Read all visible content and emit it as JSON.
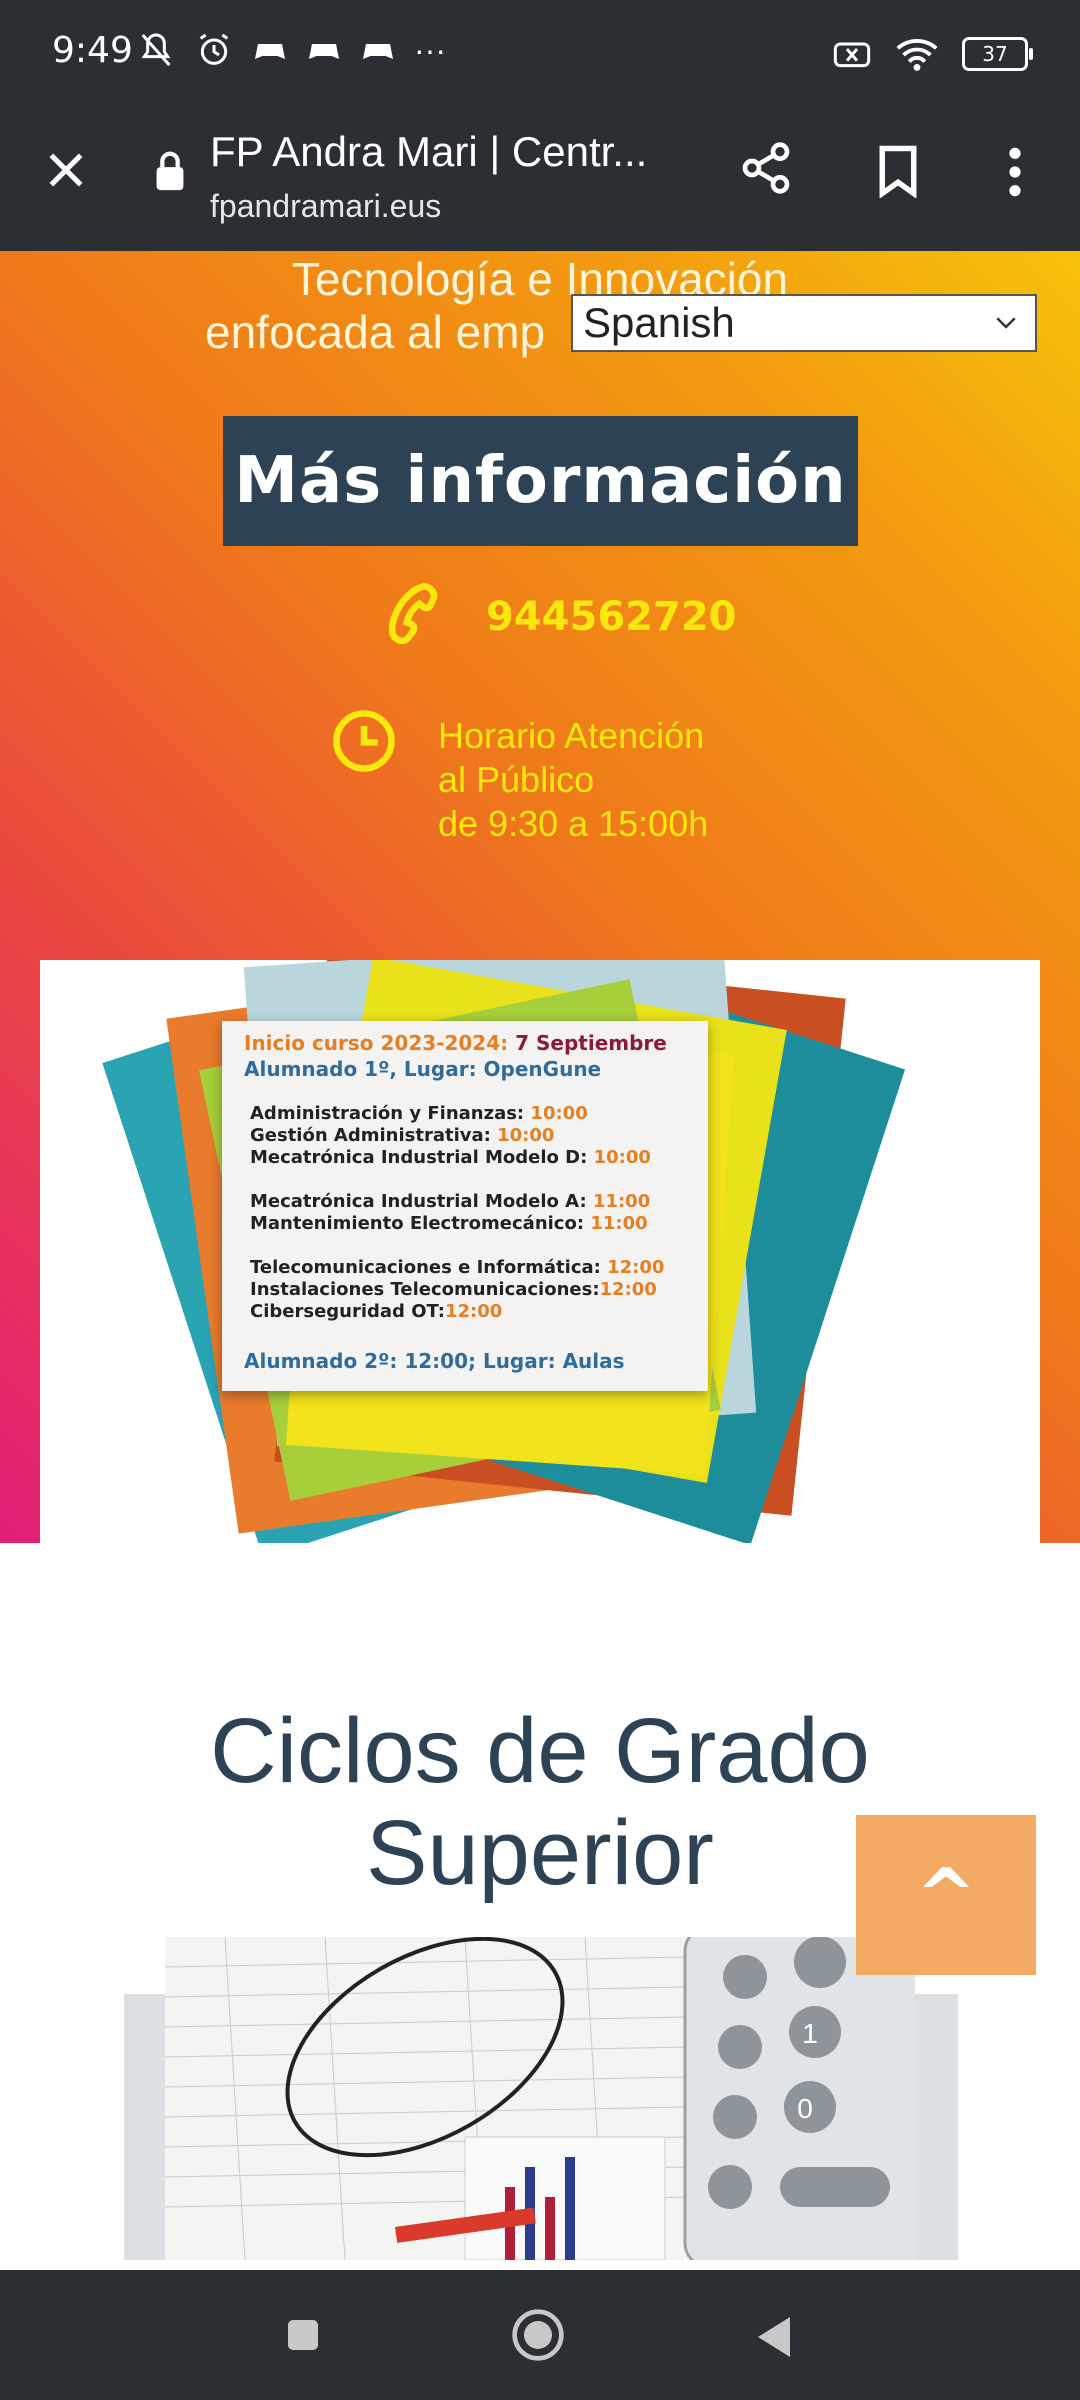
{
  "status_bar": {
    "time": "9:49",
    "battery": "37",
    "more": "···"
  },
  "browser": {
    "title": "FP Andra Mari | Centr...",
    "url": "fpandramari.eus",
    "icons": [
      "close-icon",
      "lock-icon",
      "share-icon",
      "bookmark-icon",
      "more-vert-icon"
    ]
  },
  "hero": {
    "tagline_line1": "Tecnología e Innovación",
    "tagline_line2": "enfocada al emp",
    "language_select": {
      "selected": "Spanish"
    },
    "info_button": "Más información",
    "phone": "944562720",
    "hours_line1": "Horario Atención",
    "hours_line2": "al Público",
    "hours_line3": "de 9:30 a 15:00h"
  },
  "notice": {
    "start_label": "Inicio curso 2023-2024:",
    "start_date": "7 Septiembre",
    "first_year": "Alumnado 1º, Lugar: OpenGune",
    "rows": [
      {
        "name": "Administración y Finanzas:",
        "time": "10:00"
      },
      {
        "name": "Gestión Administrativa:",
        "time": "10:00"
      },
      {
        "name": "Mecatrónica Industrial Modelo D:",
        "time": "10:00"
      },
      {
        "name": "Mecatrónica Industrial Modelo A:",
        "time": "11:00"
      },
      {
        "name": "Mantenimiento Electromecánico:",
        "time": "11:00"
      },
      {
        "name": "Telecomunicaciones e Informática:",
        "time": "12:00"
      },
      {
        "name": "Instalaciones Telecomunicaciones:",
        "time": "12:00"
      },
      {
        "name": "Ciberseguridad OT:",
        "time": "12:00"
      }
    ],
    "second_year": "Alumnado 2º: 12:00; Lugar: Aulas"
  },
  "section": {
    "title_line1": "Ciclos de Grado",
    "title_line2": "Superior"
  },
  "scroll_top": "^",
  "colors": {
    "dark_bar": "#2b2f33",
    "button_navy": "#2d4254",
    "accent_yellow": "#f9e80e",
    "scroll_orange": "#f3aa62"
  }
}
